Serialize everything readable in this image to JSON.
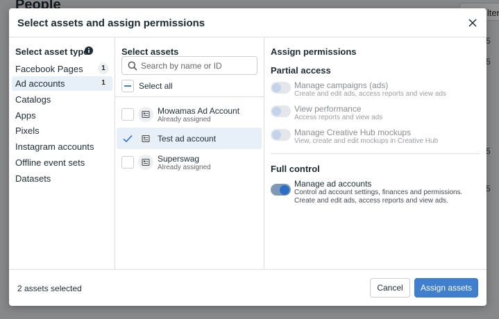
{
  "background": {
    "title": "People",
    "button": "Filters",
    "side_values": [
      "5",
      "5",
      "5",
      "5"
    ]
  },
  "modal": {
    "title": "Select assets and assign permissions"
  },
  "asset_types": {
    "heading": "Select asset type",
    "items": [
      {
        "label": "Facebook Pages",
        "count": "1",
        "active": false
      },
      {
        "label": "Ad accounts",
        "count": "1",
        "active": true
      },
      {
        "label": "Catalogs"
      },
      {
        "label": "Apps"
      },
      {
        "label": "Pixels"
      },
      {
        "label": "Instagram accounts"
      },
      {
        "label": "Offline event sets"
      },
      {
        "label": "Datasets"
      }
    ]
  },
  "assets": {
    "heading": "Select assets",
    "search_placeholder": "Search by name or ID",
    "select_all_label": "Select all",
    "items": [
      {
        "name": "Mowamas Ad Account",
        "sub": "Already assigned",
        "checked": false
      },
      {
        "name": "Test ad account",
        "sub": "",
        "checked": true
      },
      {
        "name": "Superswag",
        "sub": "Already assigned",
        "checked": false
      }
    ]
  },
  "permissions": {
    "heading": "Assign permissions",
    "partial_heading": "Partial access",
    "partial": [
      {
        "title": "Manage campaigns (ads)",
        "desc": "Create and edit ads, access reports and view ads",
        "enabled": false
      },
      {
        "title": "View performance",
        "desc": "Access reports and view ads",
        "enabled": false
      },
      {
        "title": "Manage Creative Hub mockups",
        "desc": "View, create and edit mockups in Creative Hub",
        "enabled": false
      }
    ],
    "full_heading": "Full control",
    "full": [
      {
        "title": "Manage ad accounts",
        "desc": "Control ad account settings, finances and permissions. Create and edit ads, access reports and view ads.",
        "enabled": true
      }
    ]
  },
  "footer": {
    "selected_text": "2 assets selected",
    "cancel_label": "Cancel",
    "assign_label": "Assign assets"
  },
  "colors": {
    "accent": "#3f7fcd",
    "selection": "#e7f0f9",
    "overlay": "#000000"
  }
}
